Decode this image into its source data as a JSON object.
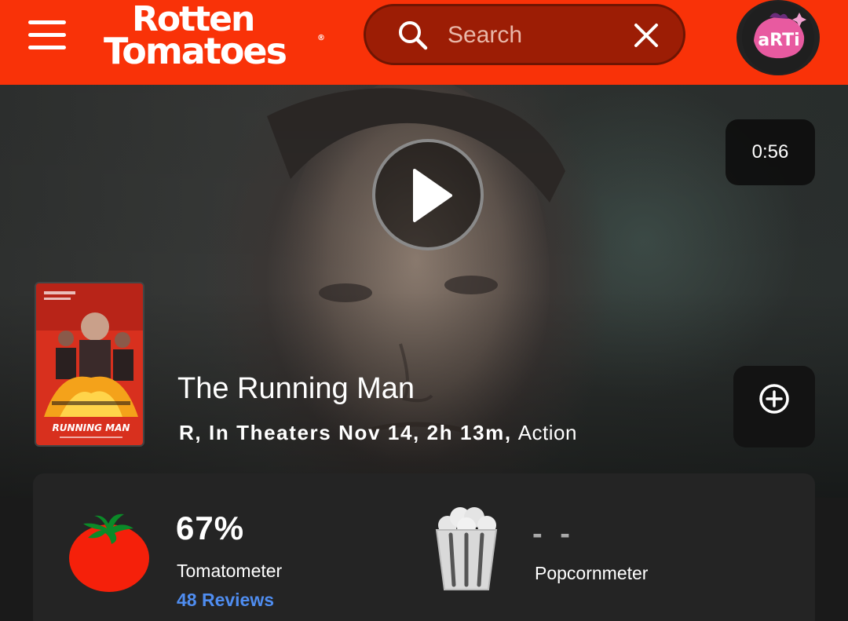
{
  "header": {
    "logo_line1": "Rotten",
    "logo_line2": "Tomatoes",
    "logo_reg": "®",
    "search_placeholder": "Search",
    "avatar_text": "aRTi"
  },
  "hero": {
    "duration": "0:56",
    "title": "The Running Man",
    "meta": "R, In Theaters Nov 14, 2h 13m,",
    "genre": "Action",
    "poster_text": "RUNNING MAN"
  },
  "scores": {
    "tomatometer_value": "67%",
    "tomatometer_label": "Tomatometer",
    "reviews_count": "48 Reviews",
    "popcornmeter_value": "- -",
    "popcornmeter_label": "Popcornmeter"
  },
  "colors": {
    "header_bg": "#f93208",
    "search_bg": "#9c1d05",
    "tomato_red": "#f5200a",
    "link_blue": "#4f8df0",
    "card_bg": "#242424"
  },
  "icons": [
    "menu-icon",
    "search-icon",
    "close-icon",
    "play-icon",
    "add-circle-icon",
    "tomato-icon",
    "popcorn-icon"
  ]
}
